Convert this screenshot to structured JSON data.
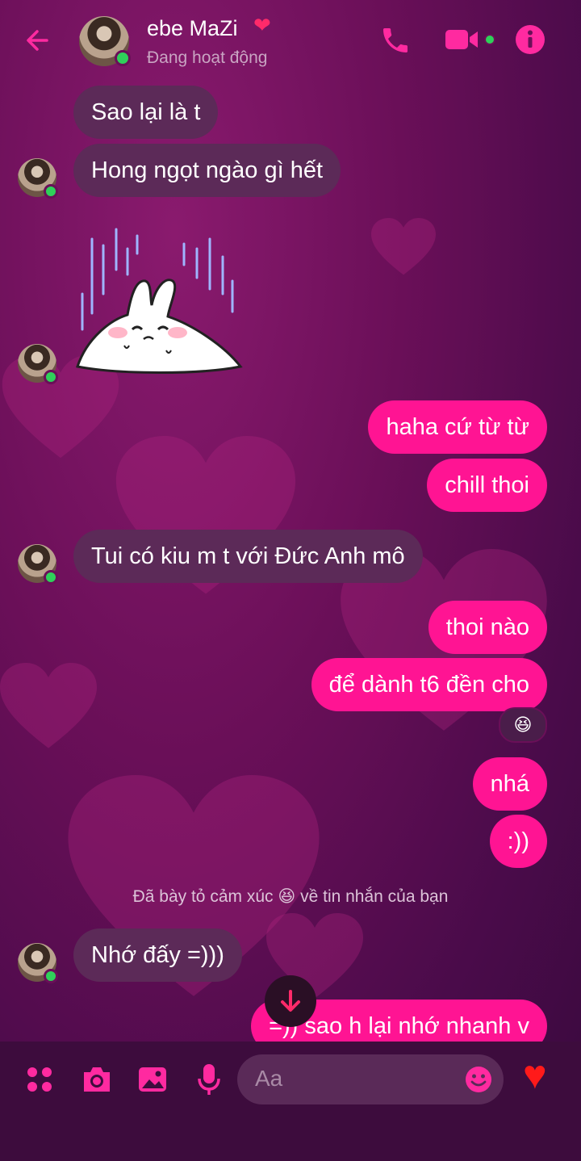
{
  "header": {
    "contact_name": "ebe MaZi",
    "name_emoji": "❤",
    "status": "Đang hoạt động"
  },
  "messages": [
    {
      "side": "in",
      "text": "Sao lại là t"
    },
    {
      "side": "in",
      "text": "Hong ngọt ngào gì hết"
    },
    {
      "side": "in",
      "type": "sticker",
      "sticker": "crying-bunny-sticker"
    },
    {
      "side": "out",
      "text": "haha cứ từ từ"
    },
    {
      "side": "out",
      "text": "chill thoi"
    },
    {
      "side": "in",
      "text": "Tui có kiu m t với Đức Anh mô"
    },
    {
      "side": "out",
      "text": "thoi nào"
    },
    {
      "side": "out",
      "text": "để dành t6 đền cho",
      "reaction": "😆"
    },
    {
      "side": "out",
      "text": "nhá"
    },
    {
      "side": "out",
      "text": ":))"
    },
    {
      "side": "in",
      "text": "Nhớ đấy =)))"
    },
    {
      "side": "out",
      "text": "=)) sao h lại nhớ nhanh v"
    }
  ],
  "system_note": {
    "before": "Đã bày tỏ cảm xúc",
    "emoji": "😆",
    "after": "về tin nhắn của bạn"
  },
  "composer": {
    "placeholder": "Aa",
    "like_emoji": "♥"
  },
  "colors": {
    "accent": "#ff1493",
    "incoming_bubble": "#5c2a58",
    "online": "#2fd05a"
  }
}
